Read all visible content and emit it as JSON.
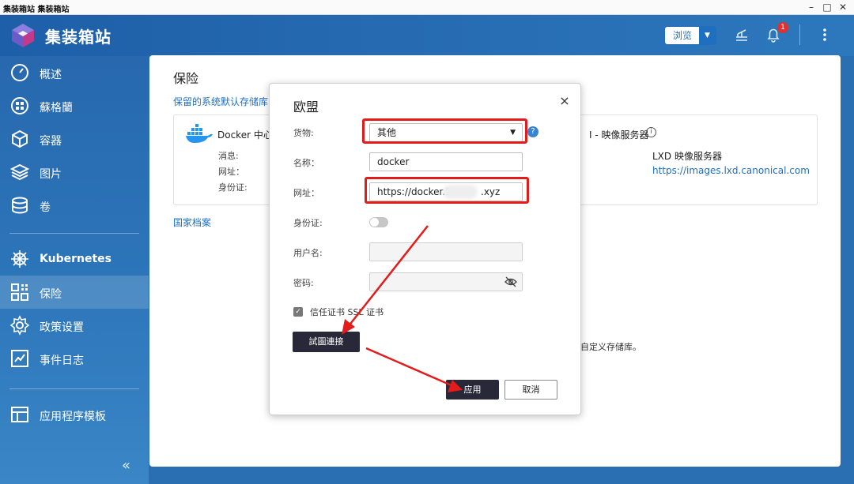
{
  "window": {
    "title": "集装箱站 集装箱站"
  },
  "app": {
    "name": "集装箱站",
    "browse_label": "浏览",
    "notification_count": "1"
  },
  "sidebar": {
    "items": [
      {
        "label": "概述",
        "icon": "gauge-icon"
      },
      {
        "label": "蘇格蘭",
        "icon": "overview-grid-icon"
      },
      {
        "label": "容器",
        "icon": "cube-icon"
      },
      {
        "label": "图片",
        "icon": "layers-icon"
      },
      {
        "label": "卷",
        "icon": "database-icon"
      },
      {
        "label": "Kubernetes",
        "icon": "helm-wheel-icon"
      },
      {
        "label": "保险",
        "icon": "registry-blocks-icon"
      },
      {
        "label": "政策设置",
        "icon": "settings-gear-icon"
      },
      {
        "label": "事件日志",
        "icon": "event-log-icon"
      },
      {
        "label": "应用程序模板",
        "icon": "template-icon"
      }
    ],
    "collapse": "«"
  },
  "page": {
    "title": "保险",
    "default_registries_link": "保留的系统默认存储库",
    "card": {
      "title": "Docker 中心",
      "rows": [
        "消息:",
        "网址：",
        "身份证:"
      ],
      "right_title": "I - 映像服务器",
      "right_subtitle": "LXD 映像服务器",
      "right_url": "https://images.lxd.canonical.com"
    },
    "national_archive_link": "国家档案",
    "custom_registry_hint": "自定义存储库。"
  },
  "dialog": {
    "title": "欧盟",
    "close": "×",
    "fields": {
      "goods_label": "货物:",
      "goods_value": "其他",
      "name_label": "名称：",
      "name_value": "docker",
      "url_label": "网址：",
      "url_value": "https://docker.1",
      "url_suffix": ".xyz",
      "id_label": "身份证:",
      "username_label": "用户名:",
      "password_label": "密码:"
    },
    "trust_ssl_label": "信任证书 SSL 证书",
    "test_button": "試圖連接",
    "apply_button": "应用",
    "cancel_button": "取消"
  },
  "colors": {
    "accent": "#1f6fc1",
    "highlight": "#e31b1b",
    "dark_button": "#282838"
  }
}
